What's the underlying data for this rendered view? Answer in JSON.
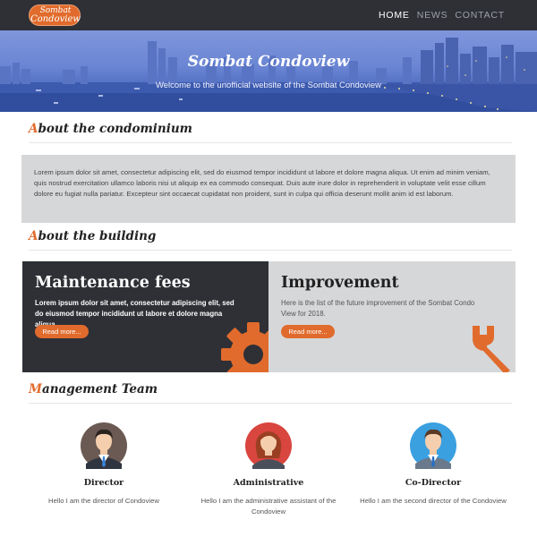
{
  "logo": {
    "line1": "Sombat",
    "line2": "Condoview"
  },
  "nav": {
    "items": [
      "HOME",
      "NEWS",
      "CONTACT"
    ],
    "active": "HOME"
  },
  "hero": {
    "title": "Sombat Condoview",
    "subtitle": "Welcome to the unofficial website of the Sombat Condoview"
  },
  "sections": {
    "about_condo": {
      "initial": "A",
      "rest": "bout the condominium"
    },
    "about_building": {
      "initial": "A",
      "rest": "bout the building"
    },
    "team": {
      "initial": "M",
      "rest": "anagement Team"
    }
  },
  "about_text": "Lorem ipsum dolor sit amet, consectetur adipiscing elit, sed do eiusmod tempor incididunt ut labore et dolore magna aliqua. Ut enim ad minim veniam, quis nostrud exercitation ullamco laboris nisi ut aliquip ex ea commodo consequat. Duis aute irure dolor in reprehenderit in voluptate velit esse cillum dolore eu fugiat nulla pariatur. Excepteur sint occaecat cupidatat non proident, sunt in culpa qui officia deserunt mollit anim id est laborum.",
  "cards": [
    {
      "title": "Maintenance fees",
      "text": "Lorem ipsum dolor sit amet, consectetur adipiscing elit, sed do eiusmod tempor incididunt ut labore et dolore magna aliqua.",
      "button": "Read more...",
      "icon": "gear-icon"
    },
    {
      "title": "Improvement",
      "text": "Here is the list of the future improvement of the Sombat Condo View for 2018.",
      "button": "Read more...",
      "icon": "wrench-icon"
    }
  ],
  "team": [
    {
      "role": "Director",
      "desc": "Hello I am the director of Condoview",
      "avatar": "male-avatar"
    },
    {
      "role": "Administrative",
      "desc": "Hello I am the administrative assistant of the Condoview",
      "avatar": "female-avatar"
    },
    {
      "role": "Co-Director",
      "desc": "Hello I am the second director of the Condoview",
      "avatar": "male-avatar"
    }
  ],
  "colors": {
    "accent": "#e06b2c",
    "dark": "#2e3036",
    "light_gray": "#d6d7d9"
  }
}
